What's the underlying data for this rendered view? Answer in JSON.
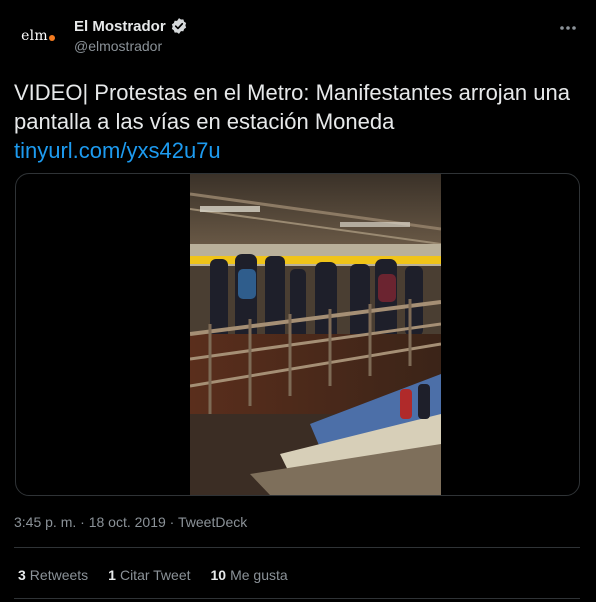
{
  "author": {
    "display_name": "El Mostrador",
    "handle": "@elmostrador",
    "avatar_text": "elm",
    "verified_icon": "verified-badge-icon",
    "accent_color": "#f47b20"
  },
  "tweet": {
    "text": "VIDEO| Protestas en el Metro: Manifestantes arrojan una pantalla a las vías en estación Moneda",
    "link": "tinyurl.com/yxs42u7u"
  },
  "media": {
    "type": "video"
  },
  "meta": {
    "time": "3:45 p. m.",
    "date": "18 oct. 2019",
    "source": "TweetDeck",
    "separator": "·"
  },
  "stats": {
    "retweets_count": "3",
    "retweets_label": "Retweets",
    "quotes_count": "1",
    "quotes_label": "Citar Tweet",
    "likes_count": "10",
    "likes_label": "Me gusta"
  },
  "colors": {
    "background": "#000000",
    "link": "#1d9bf0",
    "muted": "#8b9298"
  }
}
